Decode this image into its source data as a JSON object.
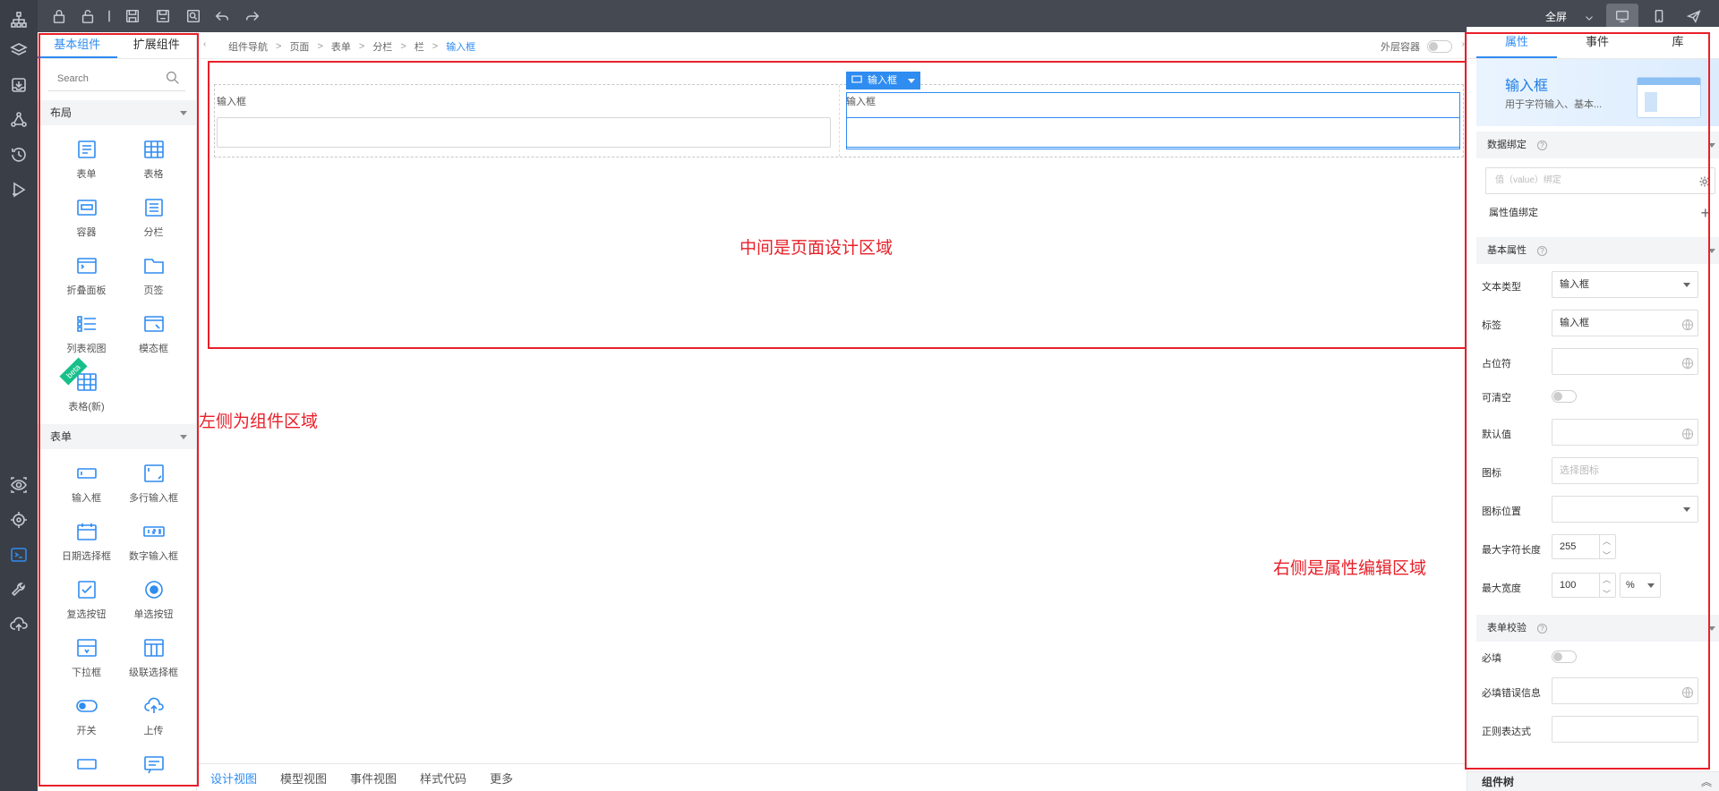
{
  "toolbar": {
    "fullscreen_label": "全屏"
  },
  "component_panel": {
    "tabs": [
      "基本组件",
      "扩展组件"
    ],
    "search_placeholder": "Search",
    "sections": [
      {
        "title": "布局",
        "items": [
          {
            "label": "表单",
            "icon": "form-icon"
          },
          {
            "label": "表格",
            "icon": "table-icon"
          },
          {
            "label": "容器",
            "icon": "container-icon"
          },
          {
            "label": "分栏",
            "icon": "columns-icon"
          },
          {
            "label": "折叠面板",
            "icon": "collapse-icon"
          },
          {
            "label": "页签",
            "icon": "folder-tab-icon"
          },
          {
            "label": "列表视图",
            "icon": "list-view-icon"
          },
          {
            "label": "模态框",
            "icon": "modal-icon"
          },
          {
            "label": "表格(新)",
            "icon": "table-icon",
            "badge": "beta"
          }
        ]
      },
      {
        "title": "表单",
        "items": [
          {
            "label": "输入框",
            "icon": "input-icon"
          },
          {
            "label": "多行输入框",
            "icon": "textarea-icon"
          },
          {
            "label": "日期选择框",
            "icon": "calendar-icon"
          },
          {
            "label": "数字输入框",
            "icon": "number-icon"
          },
          {
            "label": "复选按钮",
            "icon": "checkbox-icon"
          },
          {
            "label": "单选按钮",
            "icon": "radio-icon"
          },
          {
            "label": "下拉框",
            "icon": "select-icon"
          },
          {
            "label": "级联选择框",
            "icon": "cascader-icon"
          },
          {
            "label": "开关",
            "icon": "switch-icon"
          },
          {
            "label": "上传",
            "icon": "upload-icon"
          }
        ]
      }
    ]
  },
  "breadcrumb": {
    "items": [
      "组件导航",
      "页面",
      "表单",
      "分栏",
      "栏",
      "输入框"
    ],
    "outer_container_label": "外层容器"
  },
  "canvas": {
    "left_input_label": "输入框",
    "right_input_label": "输入框",
    "selection_tag": "输入框"
  },
  "bottom_tabs": [
    "设计视图",
    "模型视图",
    "事件视图",
    "样式代码",
    "更多"
  ],
  "property_panel": {
    "tabs": [
      "属性",
      "事件",
      "库"
    ],
    "hero_title": "输入框",
    "hero_desc": "用于字符输入、基本...",
    "data_binding": {
      "title": "数据绑定",
      "value_placeholder": "值（value）绑定",
      "attr_binding_label": "属性值绑定"
    },
    "basic": {
      "title": "基本属性",
      "rows": {
        "text_type": {
          "label": "文本类型",
          "value": "输入框"
        },
        "tag": {
          "label": "标签",
          "value": "输入框"
        },
        "placeholder": {
          "label": "占位符",
          "value": ""
        },
        "clearable": {
          "label": "可清空"
        },
        "default_value": {
          "label": "默认值",
          "value": ""
        },
        "icon": {
          "label": "图标",
          "value": "选择图标"
        },
        "icon_position": {
          "label": "图标位置",
          "value": ""
        },
        "max_length": {
          "label": "最大字符长度",
          "value": "255"
        },
        "max_width": {
          "label": "最大宽度",
          "value": "100",
          "unit": "%"
        }
      }
    },
    "validation": {
      "title": "表单校验",
      "rows": {
        "required": {
          "label": "必填"
        },
        "required_msg": {
          "label": "必填错误信息",
          "value": ""
        },
        "regex": {
          "label": "正则表达式",
          "value": ""
        }
      }
    },
    "component_tree_label": "组件树"
  },
  "annotations": {
    "left": "左侧为组件区域",
    "middle": "中间是页面设计区域",
    "right": "右侧是属性编辑区域"
  },
  "colors": {
    "accent": "#2f8cf0",
    "annotation": "#e8202a",
    "rail": "#3a3e46",
    "topbar": "#454a52"
  }
}
